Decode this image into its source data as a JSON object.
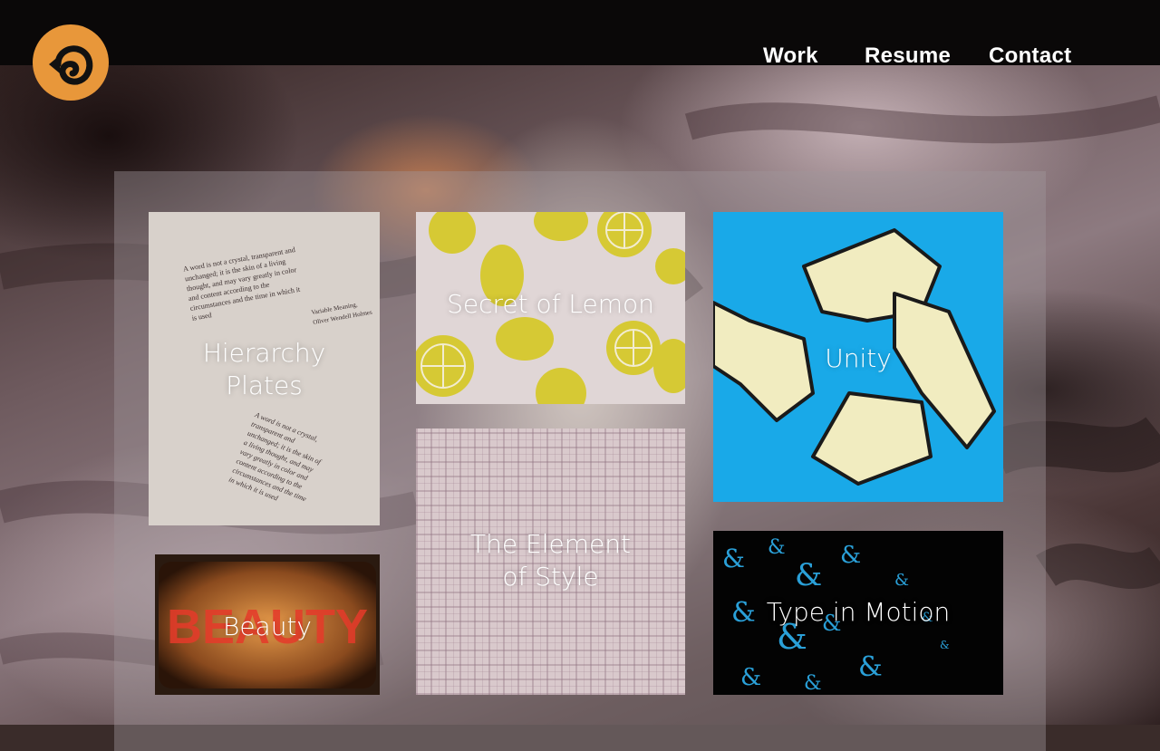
{
  "nav": {
    "items": [
      {
        "label": "Work"
      },
      {
        "label": "Resume"
      },
      {
        "label": "Contact"
      }
    ]
  },
  "logo": {
    "icon": "swirl-logo-icon",
    "color": "#e8973a"
  },
  "portfolio": {
    "tiles": [
      {
        "caption": "Hierarchy\nPlates",
        "image": "typography-plate",
        "plate_text_top": "A word is not a crystal, transparent and unchanged; it is the skin of a living thought, and may vary greatly in color and content according to the circumstances and the time in which it is used",
        "plate_attribution": "Variable Meaning,\nOliver Wendell Holmes",
        "plate_text_bottom": "A word is not a crystal, transparent and unchanged; it is the skin of a living thought, and may vary greatly in color and content according to the circumstances and the time in which it is used"
      },
      {
        "caption": "Secret of Lemon",
        "image": "lemon-pattern"
      },
      {
        "caption": "Unity",
        "image": "joined-hands"
      },
      {
        "caption": "Beauty",
        "image": "beauty-cake"
      },
      {
        "caption": "The Element\nof Style",
        "image": "plaid-fabric"
      },
      {
        "caption": "Type in Motion",
        "image": "ampersand-swirl"
      }
    ]
  },
  "colors": {
    "topbar": "#0a0808",
    "accent": "#e8973a",
    "unity_blue": "#19a9e8",
    "lemon_yellow": "#d6c934"
  }
}
